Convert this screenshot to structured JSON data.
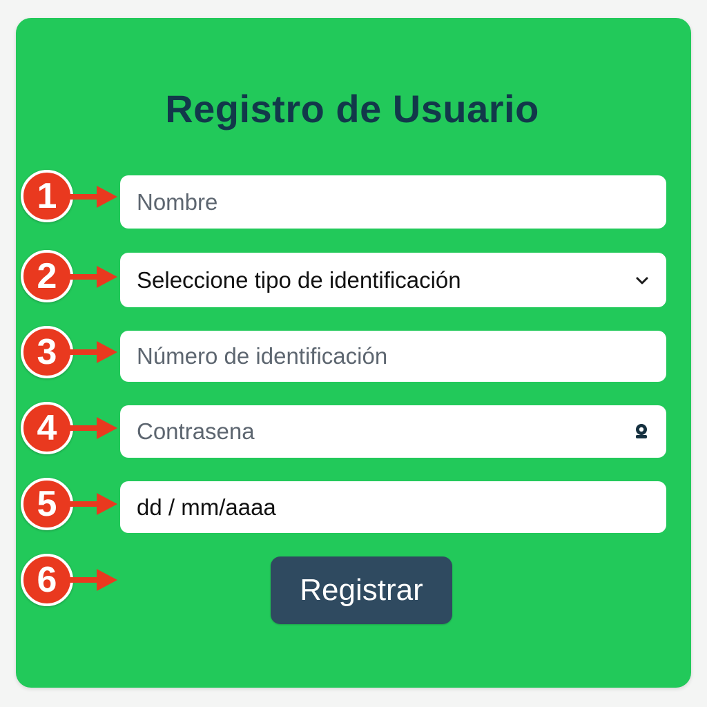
{
  "form": {
    "title": "Registro de Usuario",
    "fields": [
      {
        "placeholder": "Nombre"
      },
      {
        "selected": "Seleccione tipo de identificación",
        "icon": "chevron-down-icon"
      },
      {
        "placeholder": "Número de identificación"
      },
      {
        "placeholder": "Contrasena",
        "icon": "password-toggle-icon"
      },
      {
        "value": "dd / mm/aaaa"
      }
    ],
    "submit_label": "Registrar"
  },
  "annotations": {
    "markers": [
      "1",
      "2",
      "3",
      "4",
      "5",
      "6"
    ],
    "marker_color": "#e9391f",
    "arrow_icon": "right-arrow-icon"
  },
  "colors": {
    "card_background": "#22c95a",
    "title": "#12384a",
    "button_background": "#2f4a60"
  }
}
